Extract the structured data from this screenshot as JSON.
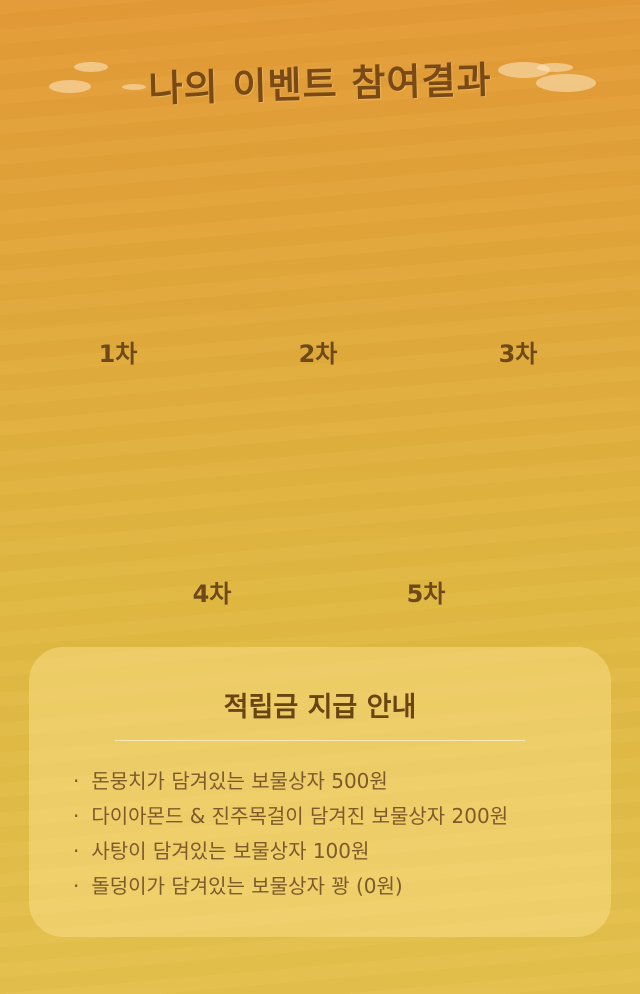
{
  "header": {
    "title": "나의 이벤트 참여결과"
  },
  "rounds": [
    {
      "label": "1차"
    },
    {
      "label": "2차"
    },
    {
      "label": "3차"
    },
    {
      "label": "4차"
    },
    {
      "label": "5차"
    }
  ],
  "info": {
    "title": "적립금 지급 안내",
    "bullet": "·",
    "items": [
      "돈뭉치가 담겨있는 보물상자 500원",
      "다이아몬드 & 진주목걸이 담겨진 보물상자 200원",
      "사탕이 담겨있는 보물상자 100원",
      "돌덩이가 담겨있는 보물상자 꽝 (0원)"
    ]
  },
  "colors": {
    "background_top": "#e39a36",
    "background_bottom": "#e4c04c",
    "title_text": "#7a4a16",
    "info_text": "#7c5a2c"
  }
}
